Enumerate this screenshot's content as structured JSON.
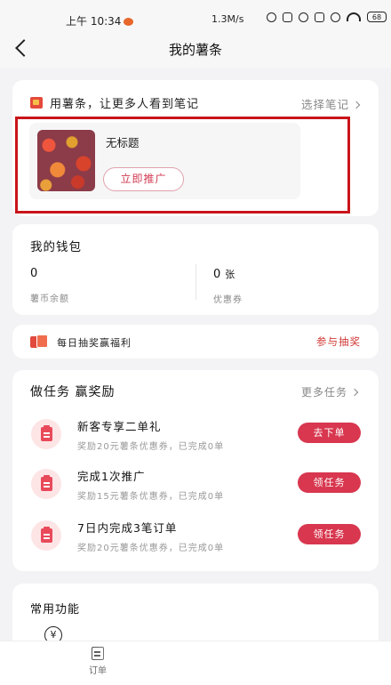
{
  "status_bar": {
    "time": "上午 10:34",
    "network_speed": "1.3M/s",
    "battery": "68"
  },
  "navbar": {
    "title": "我的薯条"
  },
  "promote": {
    "headline": "用薯条，让更多人看到笔记",
    "select_link": "选择笔记",
    "note": {
      "title": "无标题",
      "button": "立即推广"
    }
  },
  "wallet": {
    "title": "我的钱包",
    "balance_value": "0",
    "balance_label": "薯币余额",
    "coupon_value": "0",
    "coupon_unit": "张",
    "coupon_label": "优惠券"
  },
  "lottery": {
    "text": "每日抽奖赢福利",
    "link": "参与抽奖"
  },
  "tasks": {
    "title": "做任务 赢奖励",
    "more": "更多任务",
    "items": [
      {
        "name": "新客专享二单礼",
        "desc": "奖励20元薯条优惠券，已完成0单",
        "button": "去下单"
      },
      {
        "name": "完成1次推广",
        "desc": "奖励15元薯条优惠券，已完成0单",
        "button": "领任务"
      },
      {
        "name": "7日内完成3笔订单",
        "desc": "奖励20元薯条优惠券，已完成0单",
        "button": "领任务"
      }
    ]
  },
  "common": {
    "title": "常用功能",
    "yen_symbol": "¥"
  },
  "tabbar": {
    "orders_label": "订单"
  },
  "colors": {
    "accent": "#d8374f",
    "highlight_border": "#c8141a",
    "background": "#f3f3f5"
  }
}
